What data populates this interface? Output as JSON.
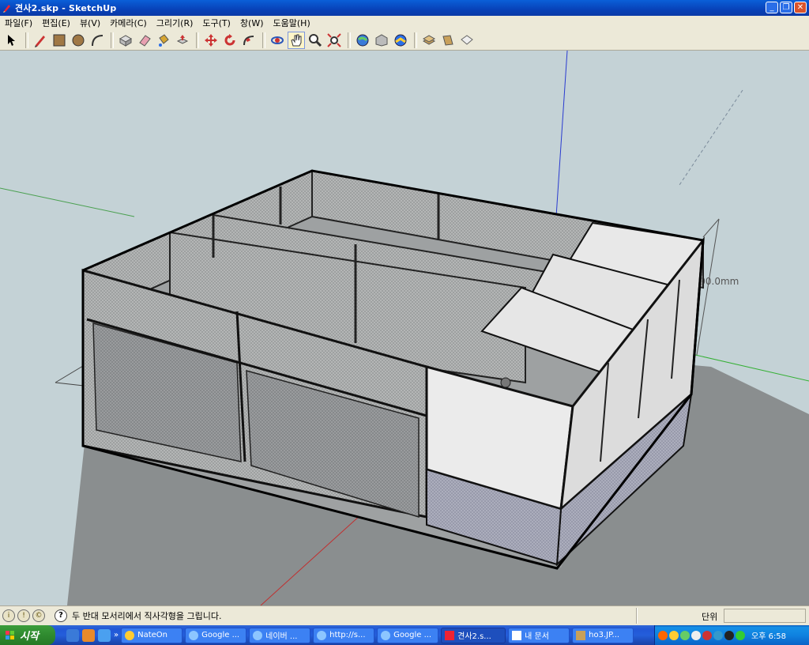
{
  "window": {
    "title": "견사2.skp - SketchUp",
    "minimize": "_",
    "maximize": "❐",
    "close": "✕"
  },
  "menu": [
    {
      "label": "파일(F)"
    },
    {
      "label": "편집(E)"
    },
    {
      "label": "뷰(V)"
    },
    {
      "label": "카메라(C)"
    },
    {
      "label": "그리기(R)"
    },
    {
      "label": "도구(T)"
    },
    {
      "label": "창(W)"
    },
    {
      "label": "도움말(H)"
    }
  ],
  "toolbar": {
    "tools": [
      "select",
      "line",
      "rectangle",
      "circle",
      "arc",
      "make-component",
      "eraser",
      "paint-bucket",
      "push-pull",
      "move",
      "rotate",
      "follow-me",
      "offset",
      "orbit",
      "pan",
      "zoom",
      "zoom-extents",
      "previous-view",
      "next-view",
      "get-models",
      "share-model",
      "warehouse",
      "layers",
      "components",
      "styles"
    ],
    "active": "pan"
  },
  "viewport": {
    "dimension": "1900.0mm"
  },
  "status": {
    "hint": "두 반대 모서리에서 직사각형을 그립니다.",
    "vcb_label": "단위",
    "vcb_value": ""
  },
  "taskbar": {
    "start": "시작",
    "quick_more": "»",
    "tasks": [
      {
        "label": "NateOn"
      },
      {
        "label": "Google ..."
      },
      {
        "label": "네이버 ..."
      },
      {
        "label": "http://s..."
      },
      {
        "label": "Google ..."
      },
      {
        "label": "견사2.s...",
        "active": true
      },
      {
        "label": "내 문서"
      },
      {
        "label": "ho3.JP..."
      }
    ],
    "clock": "오후 6:58"
  },
  "colors": {
    "sky": "#c4d2d6",
    "ground": "#8a8e8f",
    "mesh": "#b9bbbb",
    "panel": "#ebebeb"
  }
}
